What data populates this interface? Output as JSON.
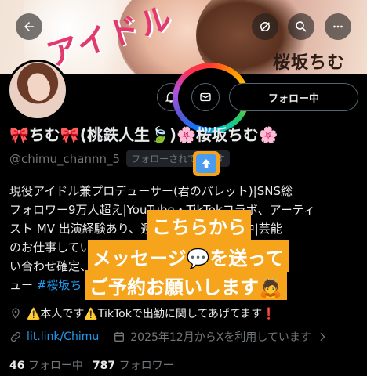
{
  "banner": {
    "title_text": "アイドル",
    "name_text": "桜坂ちむ"
  },
  "header": {
    "follow_button": "フォロー中"
  },
  "profile": {
    "display_name": "🎀ちむ🎀(桃鉄人生🍃)🌸桜坂ちむ🌸",
    "handle": "@chimu_channn_5",
    "follows_you": "フォローされています",
    "bio_lines": [
      "現役アイドル兼プロデューサー(君のパレット)|SNS総",
      "フォロワー9万人超え|YouTube・TikTokコラボ、アーティ",
      "スト MV 出演経験あり、週3回TikTokで配信中|芸能",
      "のお仕事していてお問い合わせはDMでお問",
      "い合わせ確定、お仕事依頼はDMまで🌸デビ",
      "ュー "
    ],
    "bio_tag": "#桜坂ち",
    "location": "⚠️本人です⚠️TikTokで出勤に関してあげてます❗",
    "link": "lit.link/Chimu",
    "joined": "2025年12月からXを利用しています",
    "following_count": "46",
    "following_label": "フォロー中",
    "followers_count": "787",
    "followers_label": "フォロワー"
  },
  "overlay": {
    "line1": "こちらから",
    "line2": "メッセージ💬を送って",
    "line3": "ご予約お願いします🙇"
  },
  "icons": {
    "back": "back-arrow-icon",
    "notify_off": "notification-off-icon",
    "search": "search-icon",
    "more": "more-icon",
    "bell": "bell-plus-icon",
    "mail": "mail-icon",
    "up": "up-arrow-icon",
    "location": "location-pin-icon",
    "link": "link-icon",
    "calendar": "calendar-icon",
    "chevron": "chevron-right-icon"
  },
  "colors": {
    "accent": "#1d9bf0",
    "sticker": "#f5a41c"
  }
}
